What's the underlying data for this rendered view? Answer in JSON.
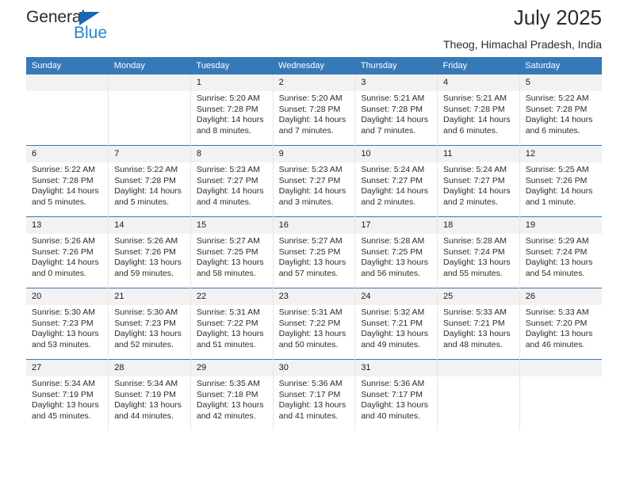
{
  "brand": {
    "name_part1": "General",
    "name_part2": "Blue",
    "triangle_icon": "triangle-icon",
    "color_dark": "#2b2b2b",
    "color_blue": "#2486d0"
  },
  "header": {
    "title": "July 2025",
    "subtitle": "Theog, Himachal Pradesh, India",
    "accent_color": "#3579b8",
    "daynum_band_color": "#f2f2f2"
  },
  "weekday_headers": [
    "Sunday",
    "Monday",
    "Tuesday",
    "Wednesday",
    "Thursday",
    "Friday",
    "Saturday"
  ],
  "weeks": [
    [
      {
        "day": "",
        "empty": true,
        "sunrise": "",
        "sunset": "",
        "daylight_1": "",
        "daylight_2": ""
      },
      {
        "day": "",
        "empty": true,
        "sunrise": "",
        "sunset": "",
        "daylight_1": "",
        "daylight_2": ""
      },
      {
        "day": "1",
        "sunrise": "Sunrise: 5:20 AM",
        "sunset": "Sunset: 7:28 PM",
        "daylight_1": "Daylight: 14 hours",
        "daylight_2": "and 8 minutes."
      },
      {
        "day": "2",
        "sunrise": "Sunrise: 5:20 AM",
        "sunset": "Sunset: 7:28 PM",
        "daylight_1": "Daylight: 14 hours",
        "daylight_2": "and 7 minutes."
      },
      {
        "day": "3",
        "sunrise": "Sunrise: 5:21 AM",
        "sunset": "Sunset: 7:28 PM",
        "daylight_1": "Daylight: 14 hours",
        "daylight_2": "and 7 minutes."
      },
      {
        "day": "4",
        "sunrise": "Sunrise: 5:21 AM",
        "sunset": "Sunset: 7:28 PM",
        "daylight_1": "Daylight: 14 hours",
        "daylight_2": "and 6 minutes."
      },
      {
        "day": "5",
        "sunrise": "Sunrise: 5:22 AM",
        "sunset": "Sunset: 7:28 PM",
        "daylight_1": "Daylight: 14 hours",
        "daylight_2": "and 6 minutes."
      }
    ],
    [
      {
        "day": "6",
        "sunrise": "Sunrise: 5:22 AM",
        "sunset": "Sunset: 7:28 PM",
        "daylight_1": "Daylight: 14 hours",
        "daylight_2": "and 5 minutes."
      },
      {
        "day": "7",
        "sunrise": "Sunrise: 5:22 AM",
        "sunset": "Sunset: 7:28 PM",
        "daylight_1": "Daylight: 14 hours",
        "daylight_2": "and 5 minutes."
      },
      {
        "day": "8",
        "sunrise": "Sunrise: 5:23 AM",
        "sunset": "Sunset: 7:27 PM",
        "daylight_1": "Daylight: 14 hours",
        "daylight_2": "and 4 minutes."
      },
      {
        "day": "9",
        "sunrise": "Sunrise: 5:23 AM",
        "sunset": "Sunset: 7:27 PM",
        "daylight_1": "Daylight: 14 hours",
        "daylight_2": "and 3 minutes."
      },
      {
        "day": "10",
        "sunrise": "Sunrise: 5:24 AM",
        "sunset": "Sunset: 7:27 PM",
        "daylight_1": "Daylight: 14 hours",
        "daylight_2": "and 2 minutes."
      },
      {
        "day": "11",
        "sunrise": "Sunrise: 5:24 AM",
        "sunset": "Sunset: 7:27 PM",
        "daylight_1": "Daylight: 14 hours",
        "daylight_2": "and 2 minutes."
      },
      {
        "day": "12",
        "sunrise": "Sunrise: 5:25 AM",
        "sunset": "Sunset: 7:26 PM",
        "daylight_1": "Daylight: 14 hours",
        "daylight_2": "and 1 minute."
      }
    ],
    [
      {
        "day": "13",
        "sunrise": "Sunrise: 5:26 AM",
        "sunset": "Sunset: 7:26 PM",
        "daylight_1": "Daylight: 14 hours",
        "daylight_2": "and 0 minutes."
      },
      {
        "day": "14",
        "sunrise": "Sunrise: 5:26 AM",
        "sunset": "Sunset: 7:26 PM",
        "daylight_1": "Daylight: 13 hours",
        "daylight_2": "and 59 minutes."
      },
      {
        "day": "15",
        "sunrise": "Sunrise: 5:27 AM",
        "sunset": "Sunset: 7:25 PM",
        "daylight_1": "Daylight: 13 hours",
        "daylight_2": "and 58 minutes."
      },
      {
        "day": "16",
        "sunrise": "Sunrise: 5:27 AM",
        "sunset": "Sunset: 7:25 PM",
        "daylight_1": "Daylight: 13 hours",
        "daylight_2": "and 57 minutes."
      },
      {
        "day": "17",
        "sunrise": "Sunrise: 5:28 AM",
        "sunset": "Sunset: 7:25 PM",
        "daylight_1": "Daylight: 13 hours",
        "daylight_2": "and 56 minutes."
      },
      {
        "day": "18",
        "sunrise": "Sunrise: 5:28 AM",
        "sunset": "Sunset: 7:24 PM",
        "daylight_1": "Daylight: 13 hours",
        "daylight_2": "and 55 minutes."
      },
      {
        "day": "19",
        "sunrise": "Sunrise: 5:29 AM",
        "sunset": "Sunset: 7:24 PM",
        "daylight_1": "Daylight: 13 hours",
        "daylight_2": "and 54 minutes."
      }
    ],
    [
      {
        "day": "20",
        "sunrise": "Sunrise: 5:30 AM",
        "sunset": "Sunset: 7:23 PM",
        "daylight_1": "Daylight: 13 hours",
        "daylight_2": "and 53 minutes."
      },
      {
        "day": "21",
        "sunrise": "Sunrise: 5:30 AM",
        "sunset": "Sunset: 7:23 PM",
        "daylight_1": "Daylight: 13 hours",
        "daylight_2": "and 52 minutes."
      },
      {
        "day": "22",
        "sunrise": "Sunrise: 5:31 AM",
        "sunset": "Sunset: 7:22 PM",
        "daylight_1": "Daylight: 13 hours",
        "daylight_2": "and 51 minutes."
      },
      {
        "day": "23",
        "sunrise": "Sunrise: 5:31 AM",
        "sunset": "Sunset: 7:22 PM",
        "daylight_1": "Daylight: 13 hours",
        "daylight_2": "and 50 minutes."
      },
      {
        "day": "24",
        "sunrise": "Sunrise: 5:32 AM",
        "sunset": "Sunset: 7:21 PM",
        "daylight_1": "Daylight: 13 hours",
        "daylight_2": "and 49 minutes."
      },
      {
        "day": "25",
        "sunrise": "Sunrise: 5:33 AM",
        "sunset": "Sunset: 7:21 PM",
        "daylight_1": "Daylight: 13 hours",
        "daylight_2": "and 48 minutes."
      },
      {
        "day": "26",
        "sunrise": "Sunrise: 5:33 AM",
        "sunset": "Sunset: 7:20 PM",
        "daylight_1": "Daylight: 13 hours",
        "daylight_2": "and 46 minutes."
      }
    ],
    [
      {
        "day": "27",
        "sunrise": "Sunrise: 5:34 AM",
        "sunset": "Sunset: 7:19 PM",
        "daylight_1": "Daylight: 13 hours",
        "daylight_2": "and 45 minutes."
      },
      {
        "day": "28",
        "sunrise": "Sunrise: 5:34 AM",
        "sunset": "Sunset: 7:19 PM",
        "daylight_1": "Daylight: 13 hours",
        "daylight_2": "and 44 minutes."
      },
      {
        "day": "29",
        "sunrise": "Sunrise: 5:35 AM",
        "sunset": "Sunset: 7:18 PM",
        "daylight_1": "Daylight: 13 hours",
        "daylight_2": "and 42 minutes."
      },
      {
        "day": "30",
        "sunrise": "Sunrise: 5:36 AM",
        "sunset": "Sunset: 7:17 PM",
        "daylight_1": "Daylight: 13 hours",
        "daylight_2": "and 41 minutes."
      },
      {
        "day": "31",
        "sunrise": "Sunrise: 5:36 AM",
        "sunset": "Sunset: 7:17 PM",
        "daylight_1": "Daylight: 13 hours",
        "daylight_2": "and 40 minutes."
      },
      {
        "day": "",
        "empty": true,
        "sunrise": "",
        "sunset": "",
        "daylight_1": "",
        "daylight_2": ""
      },
      {
        "day": "",
        "empty": true,
        "sunrise": "",
        "sunset": "",
        "daylight_1": "",
        "daylight_2": ""
      }
    ]
  ]
}
